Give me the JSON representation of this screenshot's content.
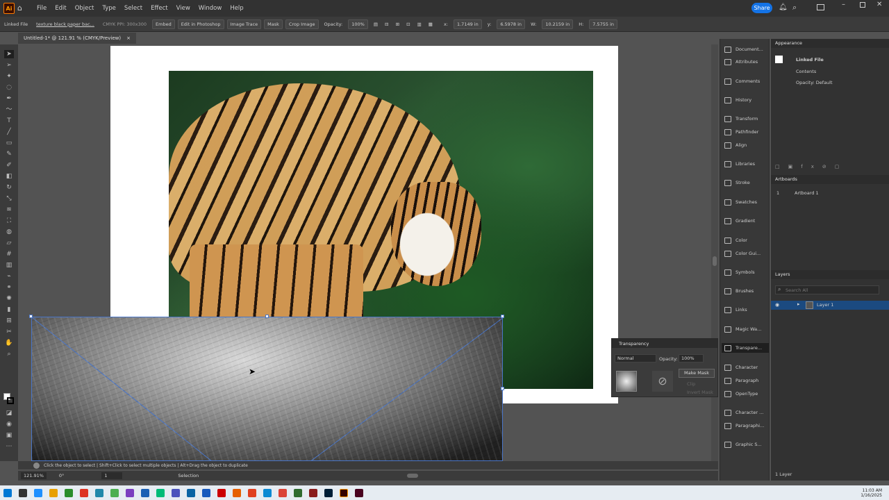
{
  "menubar": {
    "app_logo": "Ai",
    "items": [
      "File",
      "Edit",
      "Object",
      "Type",
      "Select",
      "Effect",
      "View",
      "Window",
      "Help"
    ],
    "share_label": "Share"
  },
  "control_bar": {
    "object_type": "Linked File",
    "file_name": "texture black paper bac...",
    "ppi": "CMYK  PPI: 300x300",
    "embed": "Embed",
    "edit_photoshop": "Edit in Photoshop",
    "image_trace": "Image Trace",
    "mask": "Mask",
    "crop_image": "Crop Image",
    "opacity_label": "Opacity:",
    "opacity_value": "100%",
    "x_label": "x:",
    "x_value": "1.7149 in",
    "y_label": "y:",
    "y_value": "6.5978 in",
    "w_label": "W:",
    "w_value": "10.2159 in",
    "h_label": "H:",
    "h_value": "7.5755 in"
  },
  "document_tab": {
    "title": "Untitled-1* @ 121.91 % (CMYK/Preview)",
    "close": "×"
  },
  "status": {
    "hint": "Click the object to select  |  Shift+Click to select multiple objects  |  Alt+Drag the object to duplicate",
    "zoom": "121.91%",
    "rotation": "0°",
    "artboard_num": "1",
    "tool_name": "Selection"
  },
  "dock": {
    "items": [
      "Document...",
      "Attributes",
      "Comments",
      "History",
      "Transform",
      "Pathfinder",
      "Align",
      "Libraries",
      "Stroke",
      "Swatches",
      "Gradient",
      "Color",
      "Color Gui...",
      "Symbols",
      "Brushes",
      "Links",
      "Magic Wa...",
      "Transpare...",
      "Character",
      "Paragraph",
      "OpenType",
      "Character ...",
      "Paragraphi...",
      "Graphic S..."
    ]
  },
  "appearance": {
    "title": "Appearance",
    "linked_file": "Linked File",
    "contents": "Contents",
    "opacity": "Opacity: Default"
  },
  "artboards": {
    "title": "Artboards",
    "row_num": "1",
    "row_name": "Artboard 1"
  },
  "layers": {
    "title": "Layers",
    "search_placeholder": "Search All",
    "layer_name": "Layer 1",
    "count": "1 Layer"
  },
  "transparency": {
    "title": "Transparency",
    "blend_mode": "Normal",
    "opacity_label": "Opacity:",
    "opacity_value": "100%",
    "make_mask": "Make Mask",
    "clip": "Clip",
    "invert_mask": "Invert Mask"
  },
  "taskbar": {
    "time": "11:03 AM",
    "date": "1/16/2025"
  }
}
